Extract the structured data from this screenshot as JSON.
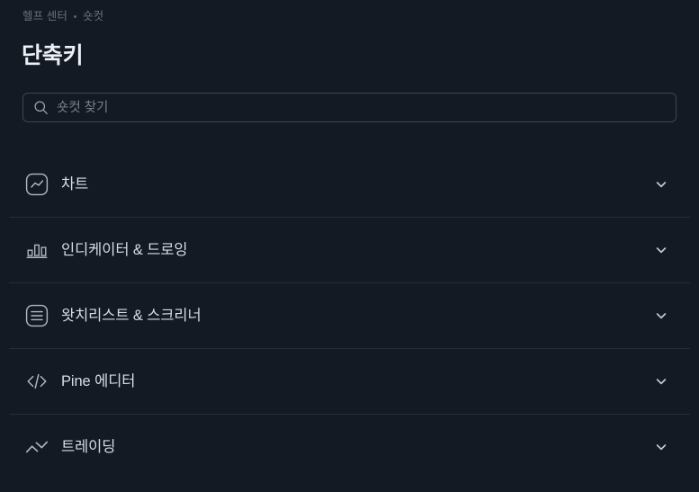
{
  "breadcrumb": {
    "items": [
      {
        "label": "헬프 센터",
        "is_link": true
      },
      {
        "label": "숏컷",
        "is_link": false
      }
    ],
    "separator_icon": "bullet-dot-icon"
  },
  "page": {
    "title": "단축키"
  },
  "search": {
    "placeholder": "숏컷 찾기",
    "value": "",
    "icon": "search-icon"
  },
  "sections": [
    {
      "label": "차트",
      "icon": "chart-line-icon",
      "expand_icon": "chevron-down-icon",
      "expanded": false
    },
    {
      "label": "인디케이터 & 드로잉",
      "icon": "bar-chart-icon",
      "expand_icon": "chevron-down-icon",
      "expanded": false
    },
    {
      "label": "왓치리스트 & 스크리너",
      "icon": "list-lines-icon",
      "expand_icon": "chevron-down-icon",
      "expanded": false
    },
    {
      "label": "Pine 에디터",
      "icon": "code-brackets-icon",
      "expand_icon": "chevron-down-icon",
      "expanded": false
    },
    {
      "label": "트레이딩",
      "icon": "double-chevron-swap-icon",
      "expand_icon": "chevron-down-icon",
      "expanded": false
    }
  ],
  "colors": {
    "background": "#131a24",
    "title_text": "#eceff4",
    "body_text": "#d9dce3",
    "muted_text": "#6a7180",
    "placeholder_text": "#787f8c",
    "border": "#3d4550",
    "divider": "#272d38",
    "icon_stroke": "#b2b8c4"
  }
}
